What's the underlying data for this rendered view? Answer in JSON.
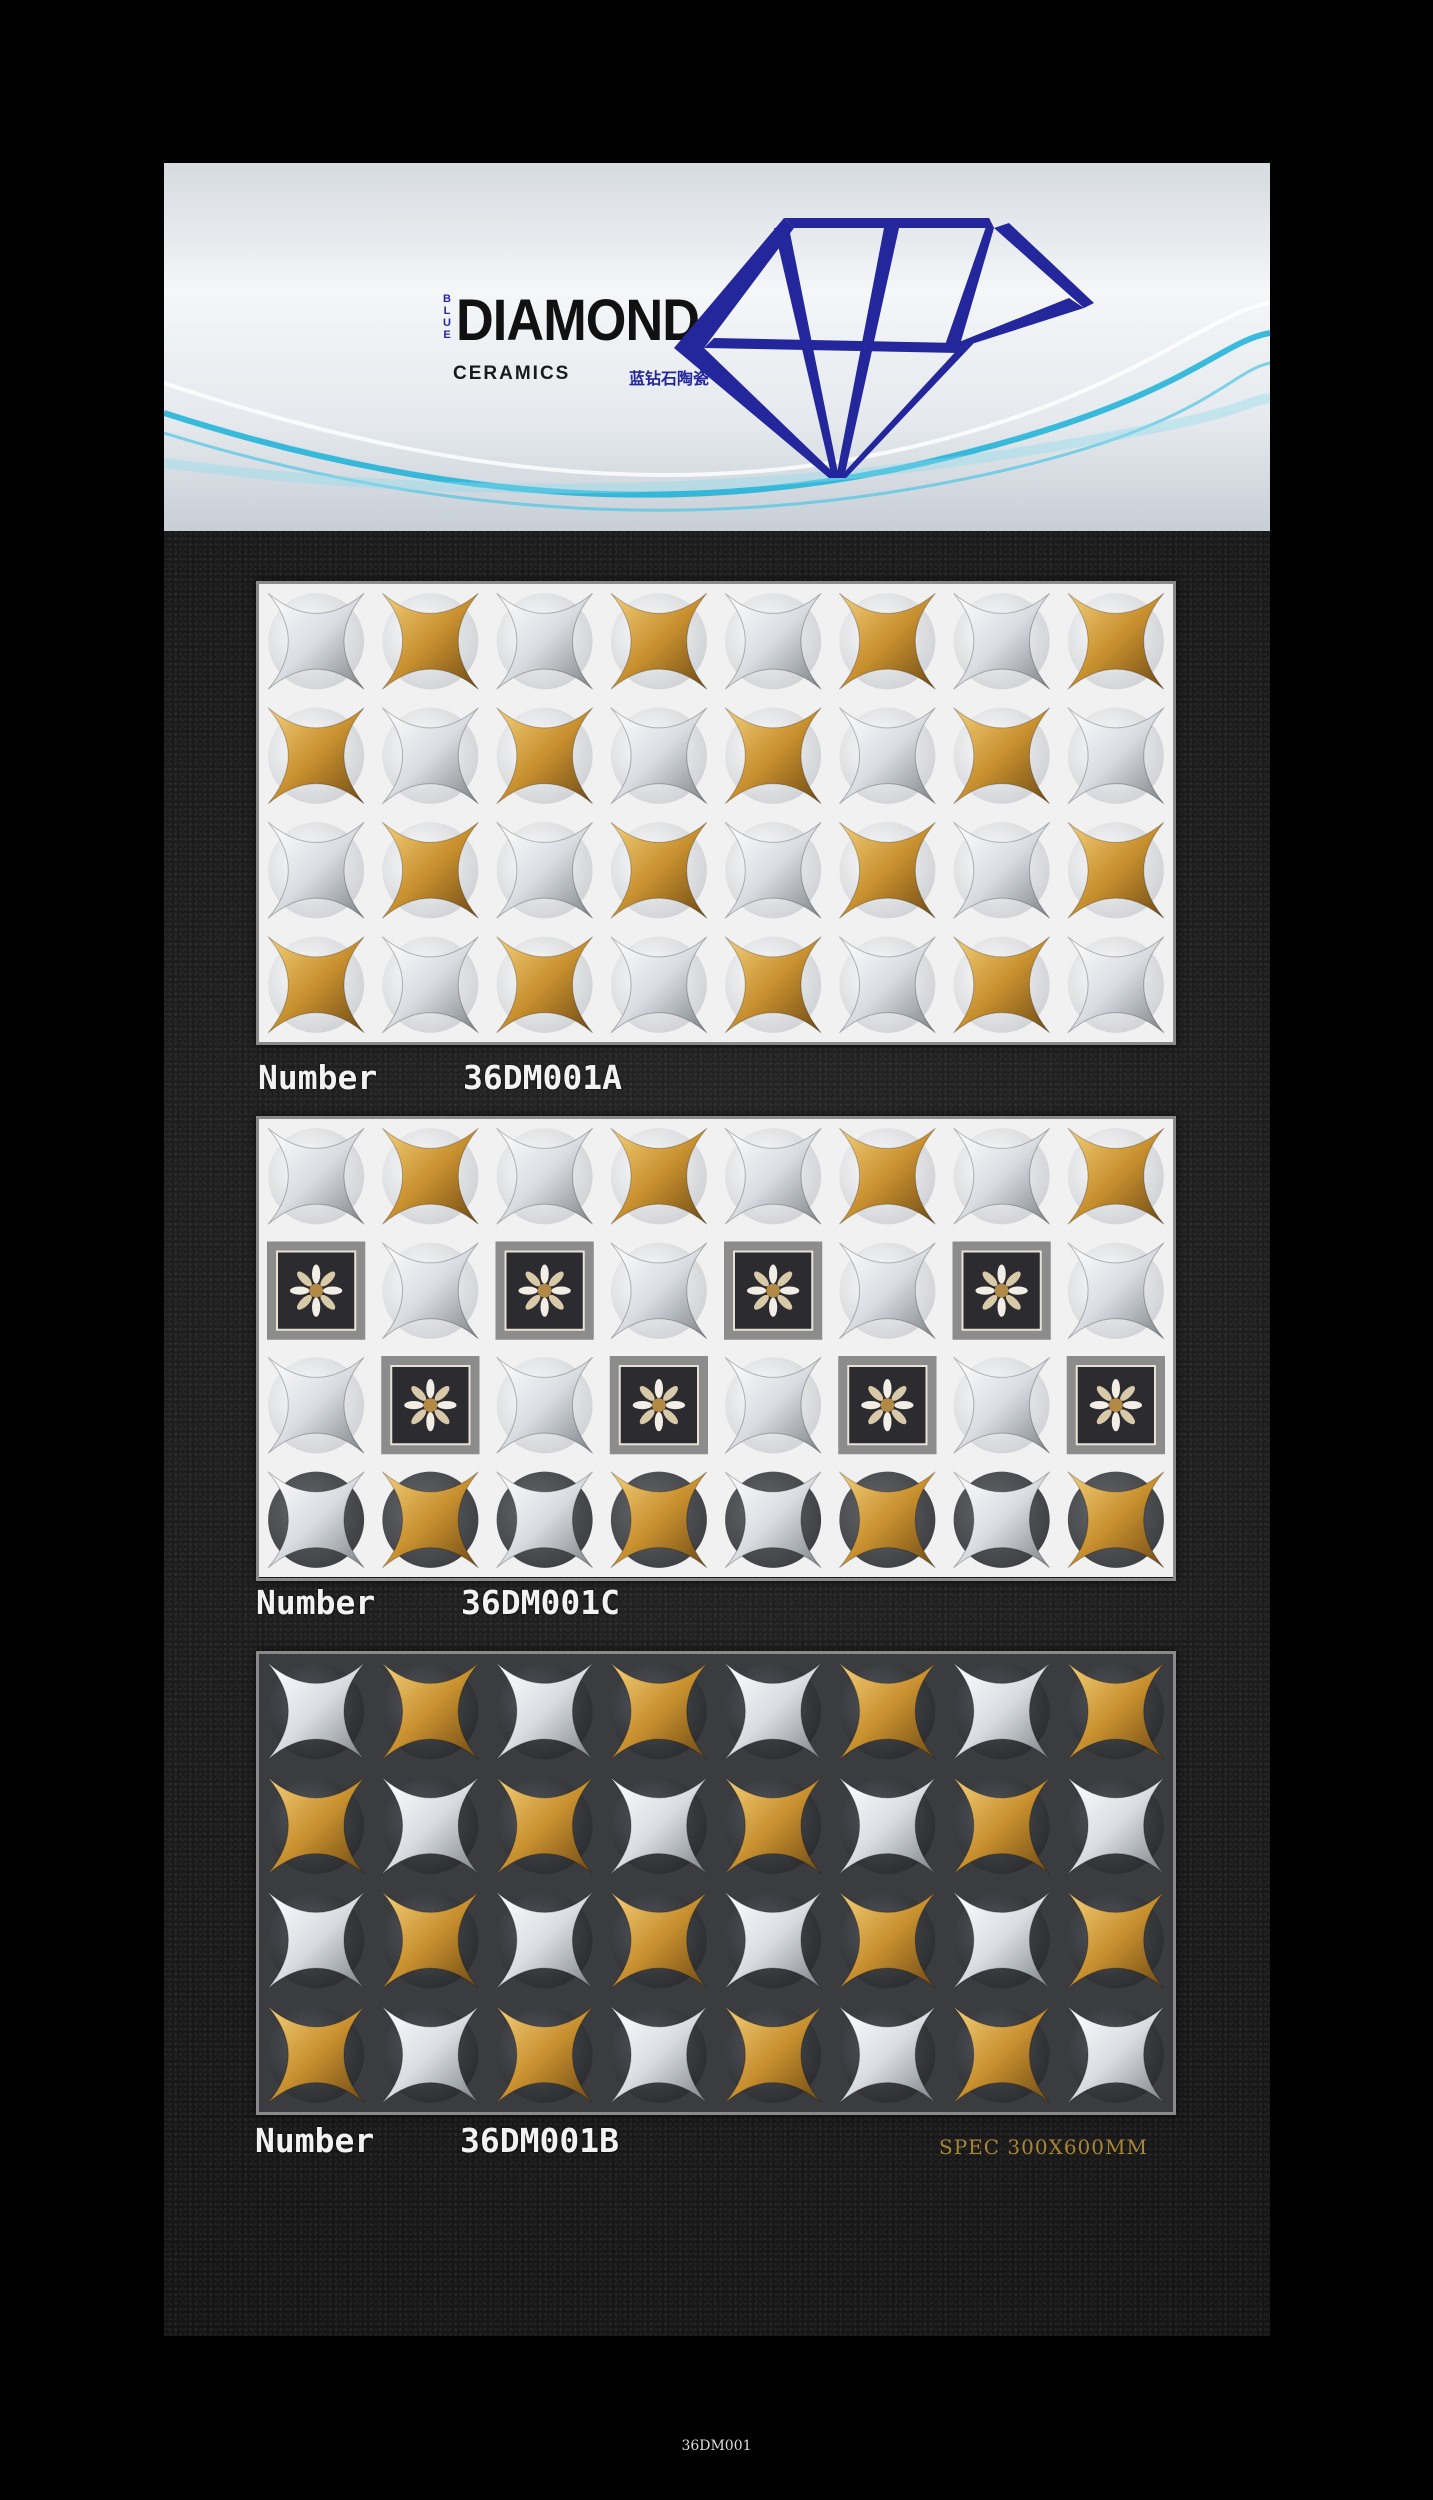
{
  "brand": {
    "blue_letters": [
      "B",
      "L",
      "U",
      "E"
    ],
    "name": "DIAMOND",
    "subtitle": "CERAMICS",
    "chinese_name": "蓝钻石陶瓷",
    "accent_color": "#23279b",
    "wave_color": "#1ab2d8"
  },
  "tiles": [
    {
      "label": "Number",
      "code": "36DM001A",
      "pattern": "white-gold-silver-stars",
      "rows": 4,
      "cols": 8
    },
    {
      "label": "Number",
      "code": "36DM001C",
      "pattern": "white-with-decor-insets-dark-border",
      "rows": 4,
      "cols": 8
    },
    {
      "label": "Number",
      "code": "36DM001B",
      "pattern": "dark-gold-silver-stars",
      "rows": 4,
      "cols": 8
    }
  ],
  "spec": "SPEC  300X600MM",
  "footer": "36DM001",
  "colors": {
    "gold": "#c8902f",
    "silver": "#d9dde2",
    "white_tile": "#f1f1f1",
    "dark_tile": "#3a3c40"
  }
}
